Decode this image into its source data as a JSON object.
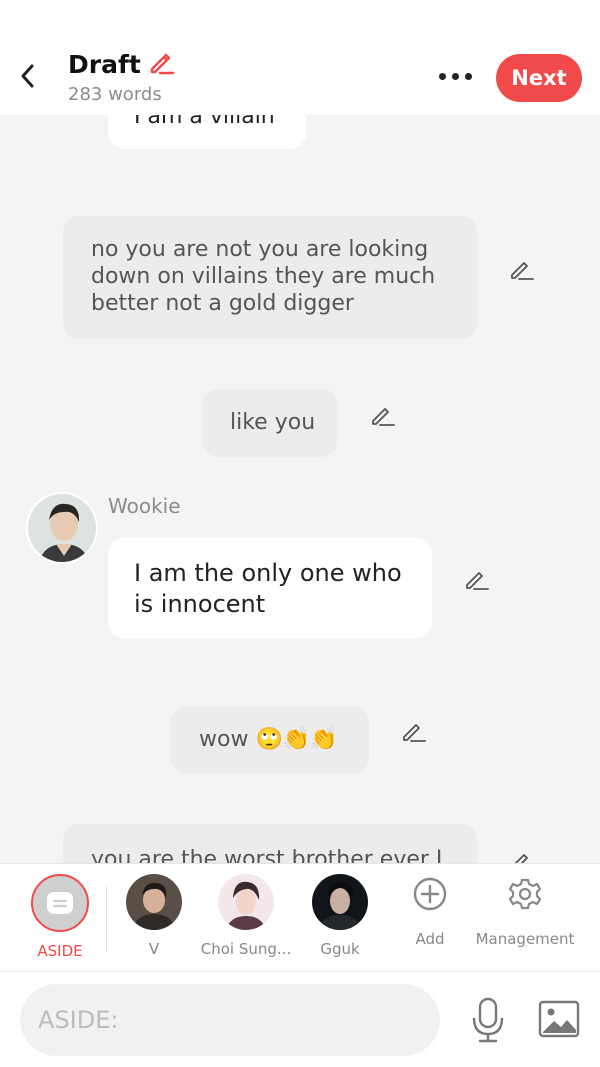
{
  "header": {
    "back_icon": "chevron-left-icon",
    "title": "Draft",
    "title_icon": "pencil-icon",
    "word_count": "283 words",
    "more_icon": "more-dots-icon",
    "next_label": "Next",
    "accent_color": "#f04a4a"
  },
  "messages": [
    {
      "speaker": "",
      "text": "I am a villain",
      "style": "white"
    },
    {
      "speaker": "",
      "text": "no you are not you are looking down on villains they are much better not a gold digger",
      "style": "grey"
    },
    {
      "speaker": "",
      "text": "like you",
      "style": "grey"
    },
    {
      "speaker": "Wookie",
      "text": "I am the only one who is innocent",
      "style": "white"
    },
    {
      "speaker": "",
      "text": "wow 🙄👏👏",
      "style": "grey"
    },
    {
      "speaker": "",
      "text": "you are the worst brother ever I",
      "style": "grey"
    }
  ],
  "characters": [
    {
      "name": "ASIDE",
      "active": true
    },
    {
      "name": "V"
    },
    {
      "name": "Choi Sung..."
    },
    {
      "name": "Gguk"
    },
    {
      "name": "Add",
      "icon": "plus-circle-icon"
    },
    {
      "name": "Management",
      "icon": "gear-icon"
    }
  ],
  "input": {
    "placeholder": "ASIDE:",
    "mic_icon": "microphone-icon",
    "image_icon": "image-icon"
  }
}
